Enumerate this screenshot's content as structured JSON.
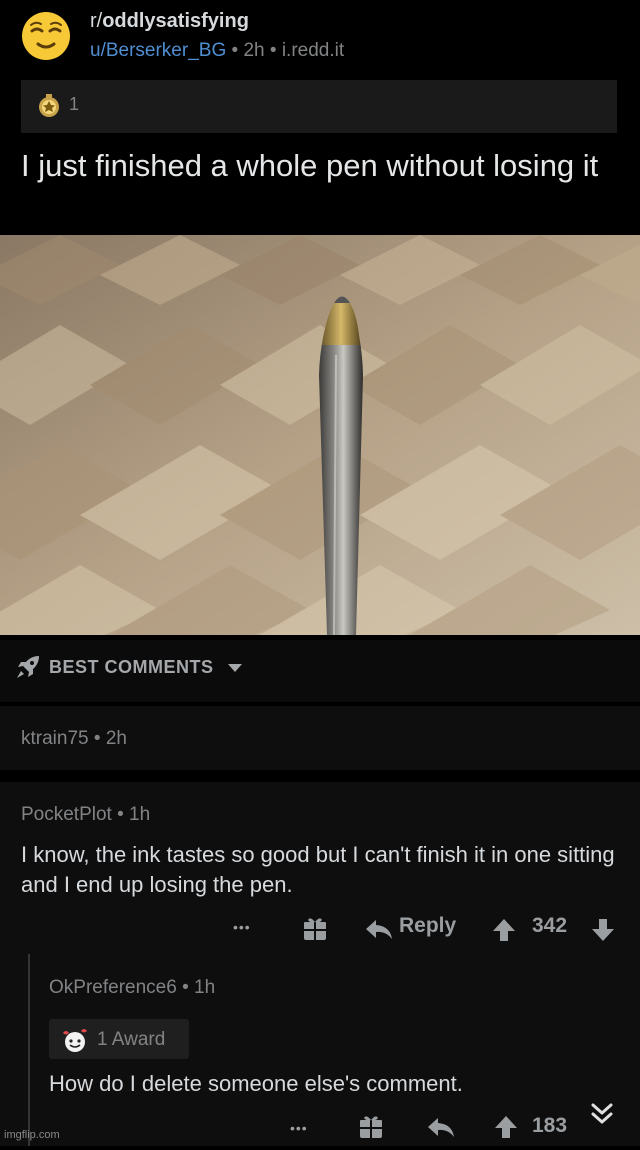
{
  "post": {
    "subreddit_prefix": "r/",
    "subreddit": "oddlysatisfying",
    "author": "u/Berserker_BG",
    "age": "2h",
    "domain": "i.redd.it",
    "award_count": "1",
    "title": "I just finished a whole pen without losing it"
  },
  "sort": {
    "label": "BEST COMMENTS"
  },
  "collapsed_comment": {
    "author": "ktrain75",
    "age": "2h"
  },
  "comment": {
    "author": "PocketPlot",
    "age": "1h",
    "body": "I know, the ink tastes so good but I can't finish it in one sitting and I end up losing the pen.",
    "more": "•••",
    "reply_label": "Reply",
    "score": "342"
  },
  "reply": {
    "author": "OkPreference6",
    "age": "1h",
    "award_label": "1 Award",
    "body": "How do I delete someone else's comment.",
    "more": "•••",
    "score": "183"
  },
  "watermark": "imgflip.com",
  "separator": "•",
  "colors": {
    "link": "#4f8ed1",
    "bg": "#000000",
    "card": "#0e0e0f",
    "muted": "#818384"
  }
}
